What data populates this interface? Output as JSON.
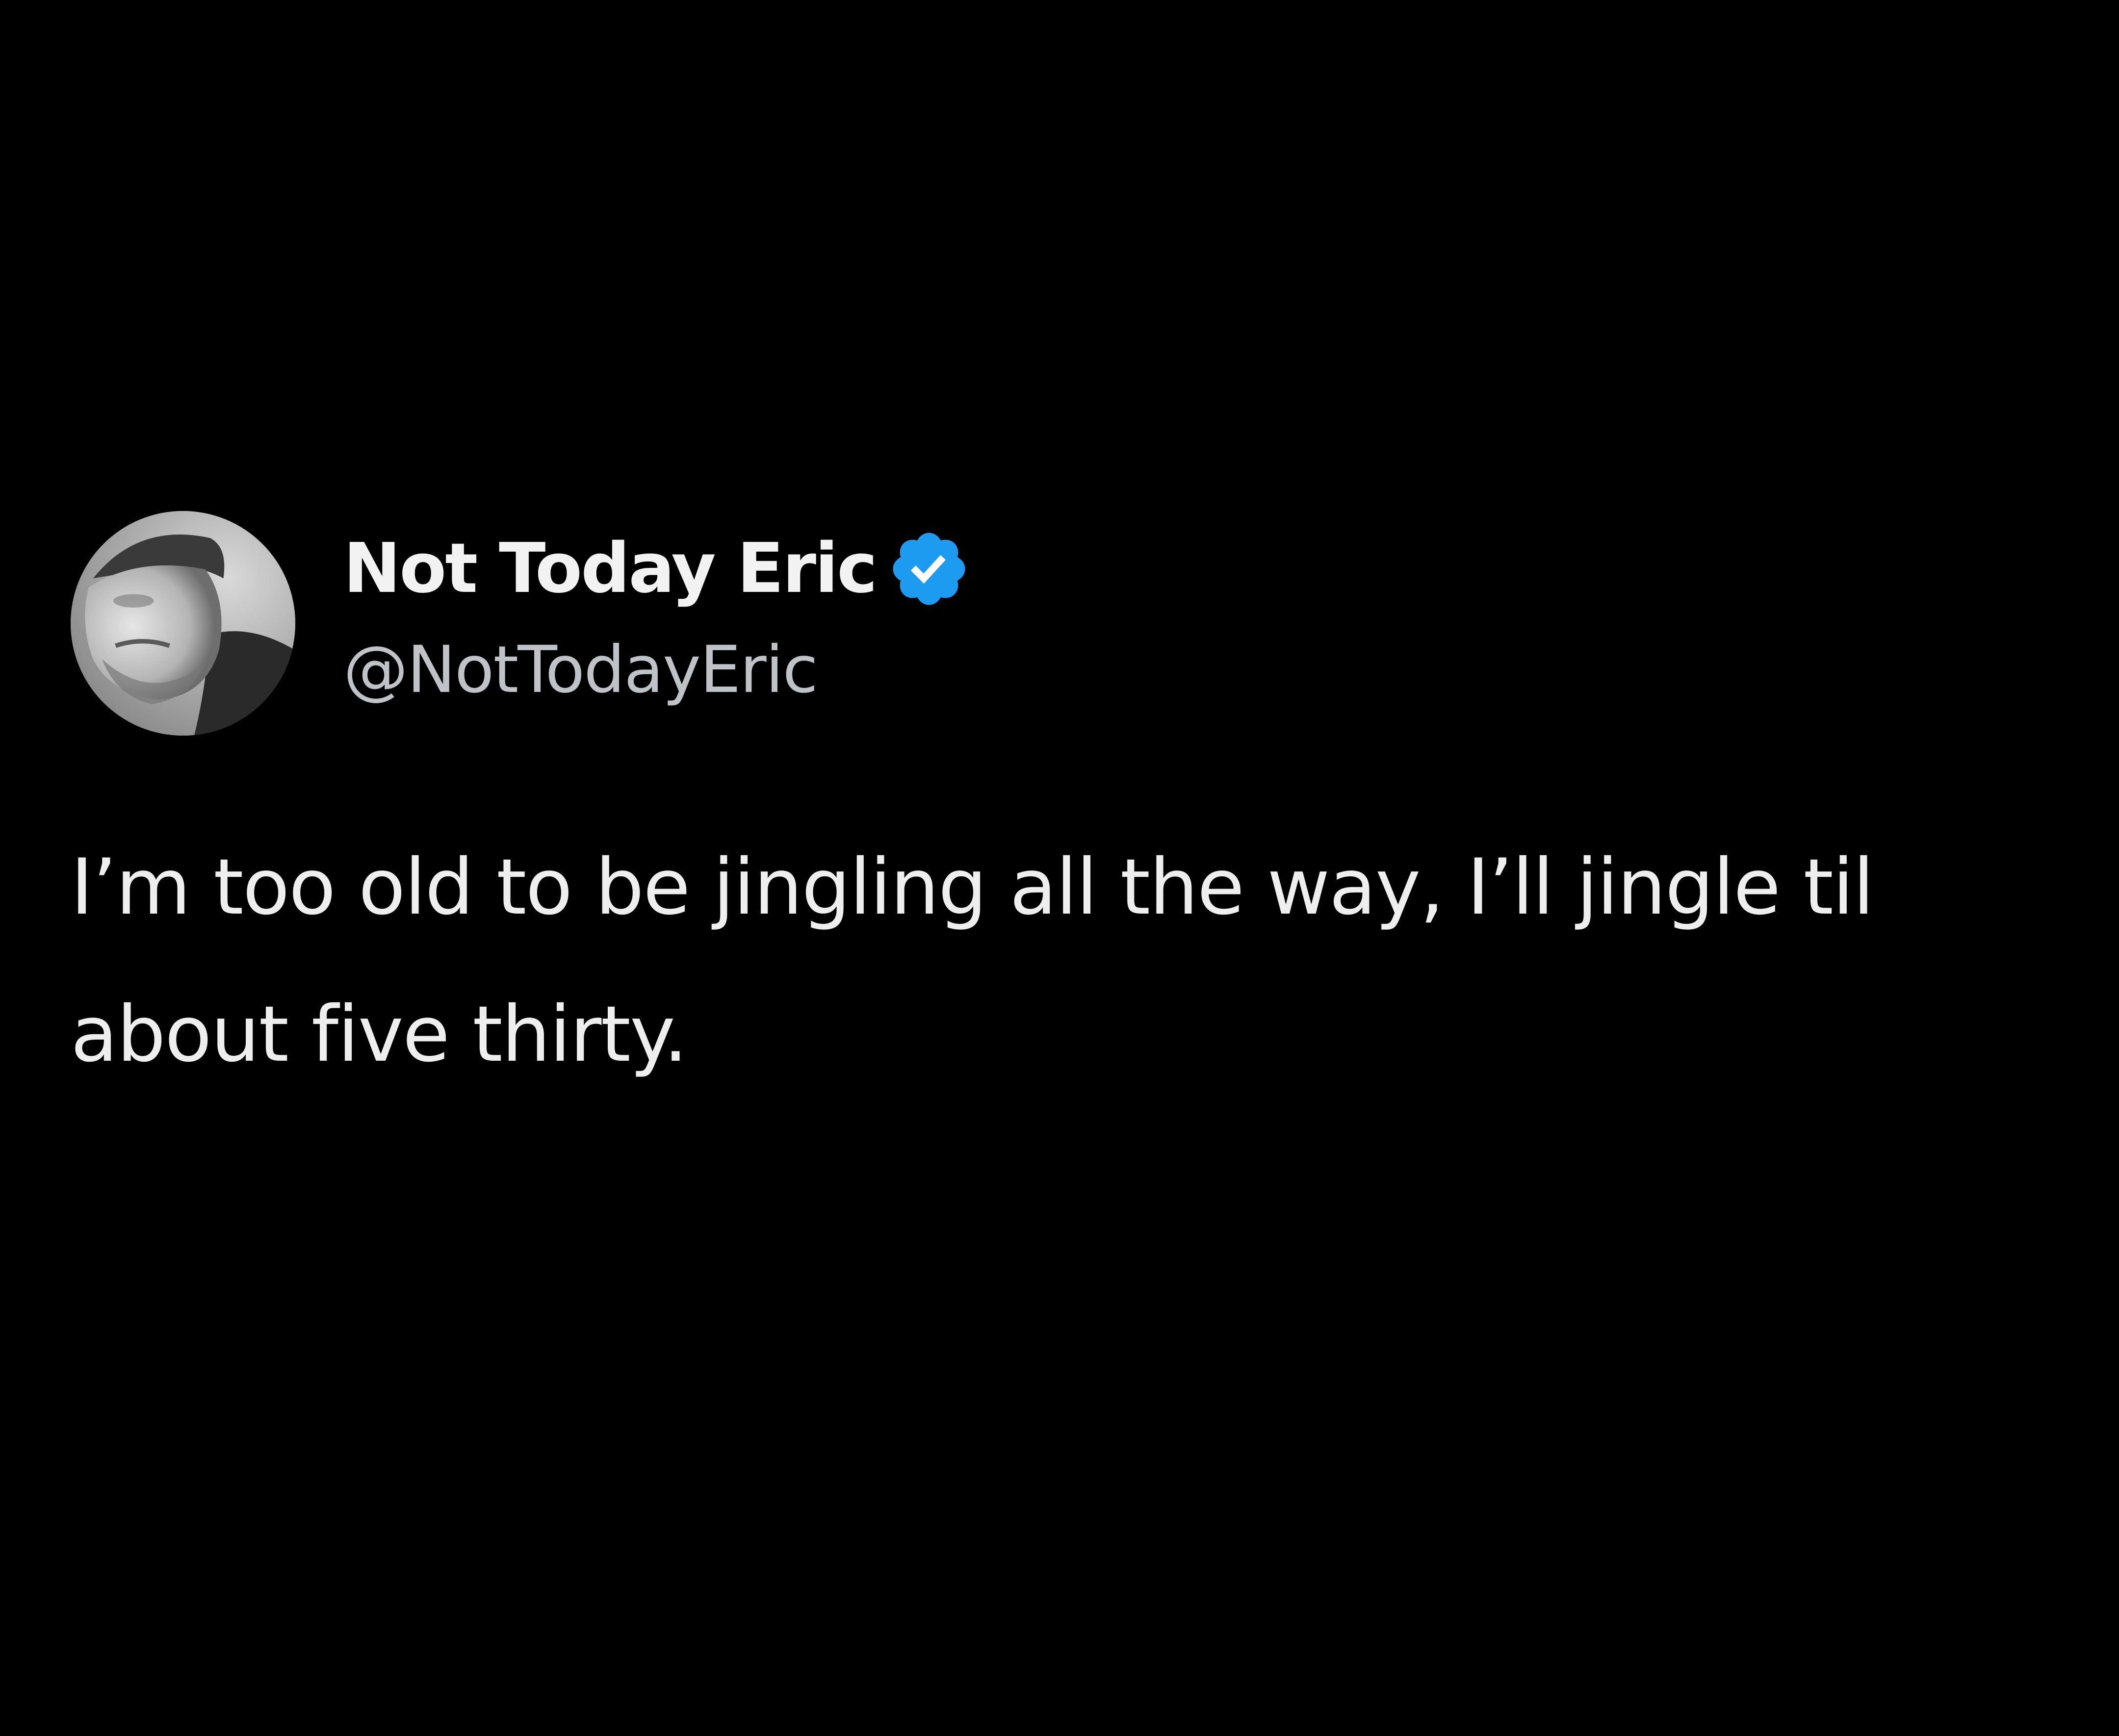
{
  "author": {
    "display_name": "Not Today Eric",
    "handle": "@NotTodayEric",
    "verified": true
  },
  "tweet": {
    "text": "I’m too old to be jingling all the way, I’ll jingle til about five thirty."
  },
  "colors": {
    "background": "#000000",
    "text": "#eeeeee",
    "handle": "#bfc3c7",
    "verified_badge": "#1d9bf0"
  },
  "icons": {
    "verified": "verified-badge-icon",
    "avatar": "profile-photo"
  }
}
